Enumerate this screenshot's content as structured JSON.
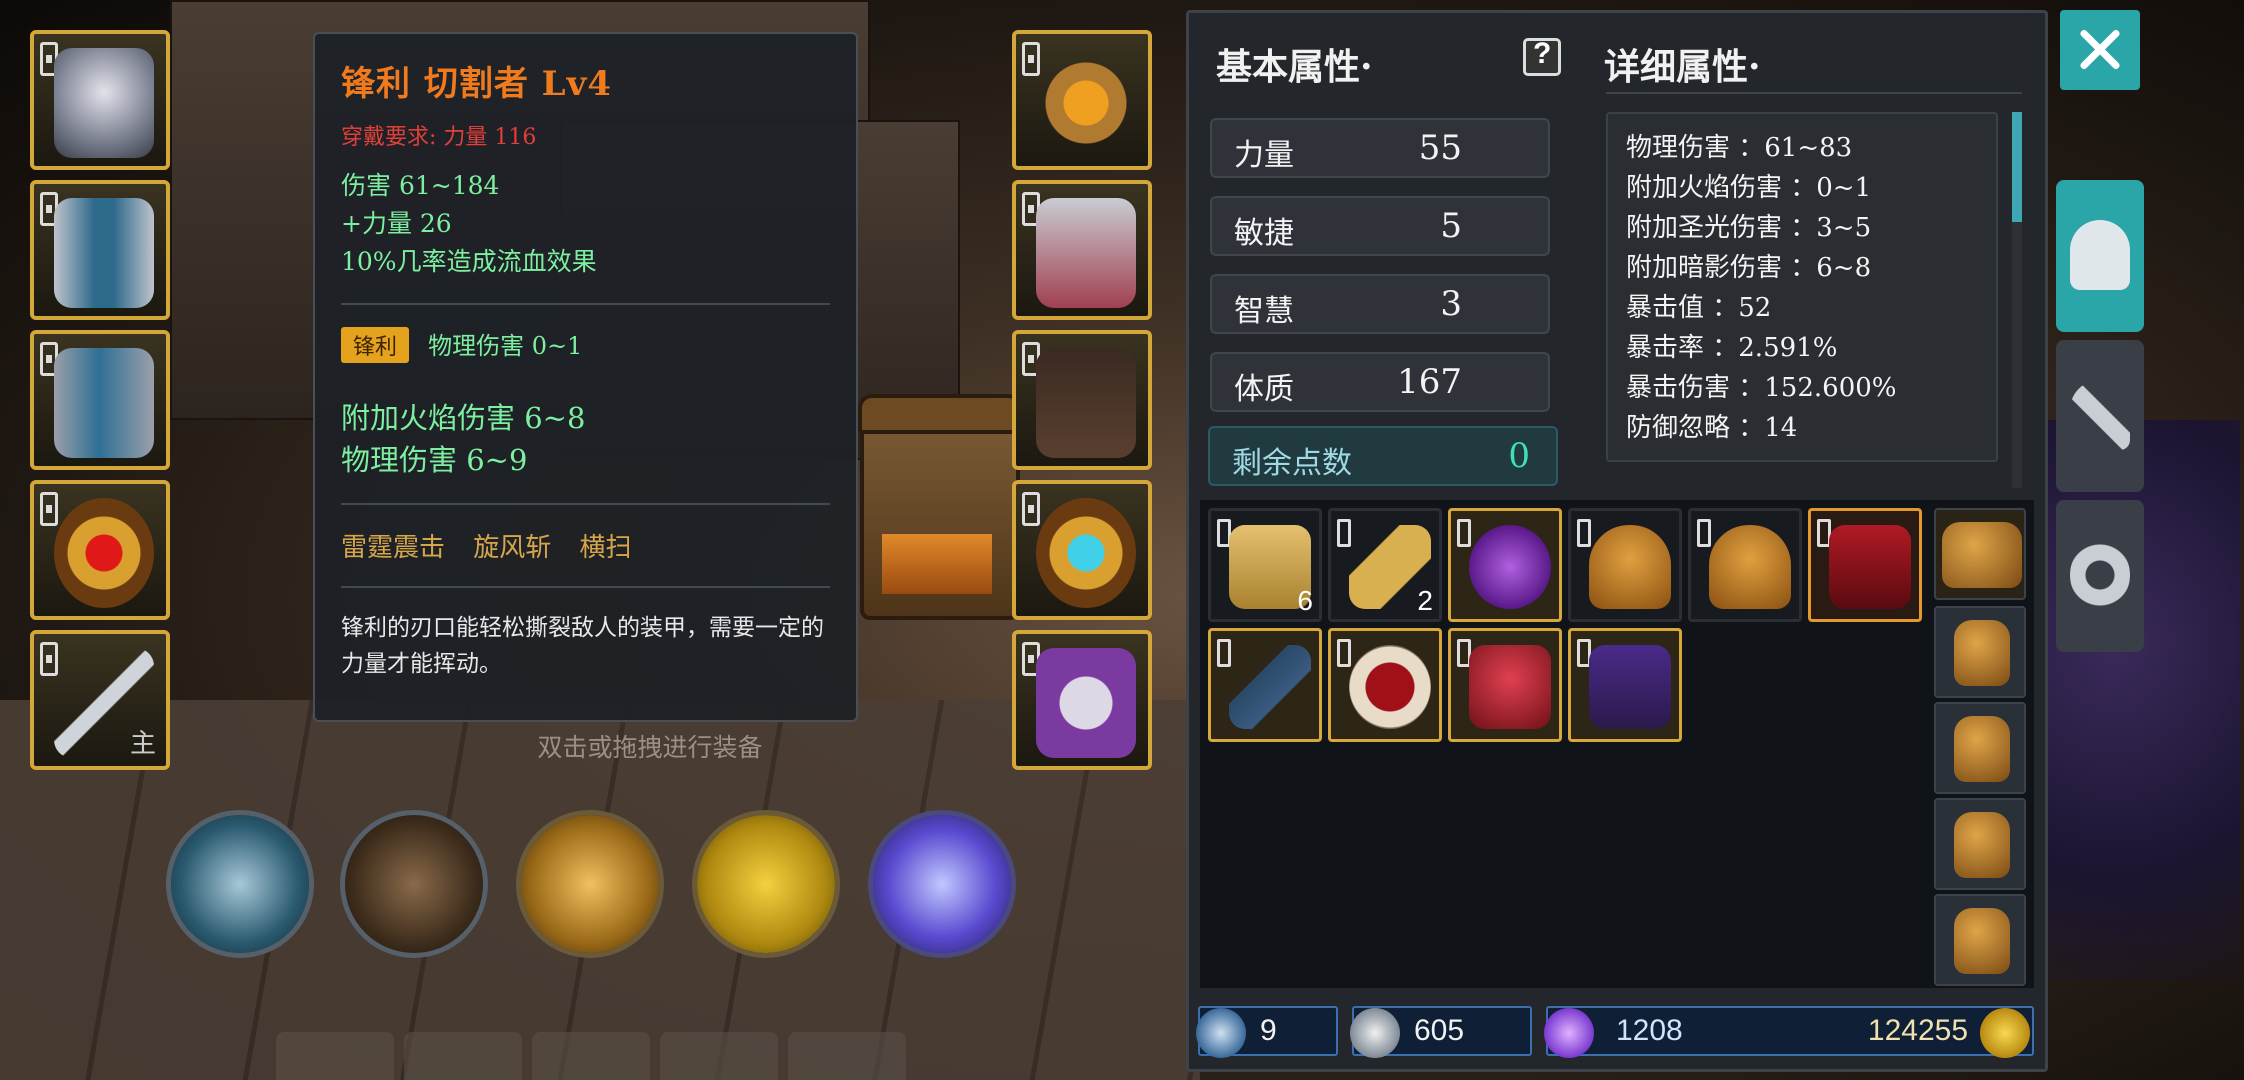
{
  "tooltip": {
    "title": "锋利 切割者 Lv4",
    "requirement": "穿戴要求:    力量 116",
    "lines": [
      "伤害   61~184",
      "+力量 26",
      "10%几率造成流血效果"
    ],
    "affix_badge": "锋利",
    "affix_text": "物理伤害 0~1",
    "bonus": [
      "附加火焰伤害  6~8",
      "物理伤害  6~9"
    ],
    "skills": "雷霆震击  旋风斩  横扫",
    "description": "锋利的刃口能轻松撕裂敌人的装甲，需要一定的力量才能挥动。"
  },
  "hint": "双击或拖拽进行装备",
  "left_slots": [
    {
      "icon": "helmet-icon"
    },
    {
      "icon": "armor-icon"
    },
    {
      "icon": "leg-armor-icon"
    },
    {
      "icon": "ring-icon"
    },
    {
      "icon": "sword-icon",
      "tag": "主"
    }
  ],
  "right_slots": [
    {
      "icon": "amulet-icon"
    },
    {
      "icon": "gloves-icon"
    },
    {
      "icon": "boots-icon"
    },
    {
      "icon": "ring-icon"
    },
    {
      "icon": "skull-offhand-icon"
    }
  ],
  "skills": [
    {
      "icon": "blade-skill-icon"
    },
    {
      "icon": "helmet-strike-skill-icon"
    },
    {
      "icon": "fist-burst-skill-icon"
    },
    {
      "icon": "dash-skill-icon"
    },
    {
      "icon": "boot-skill-icon"
    }
  ],
  "panel": {
    "basic_title": "基本属性·",
    "detail_title": "详细属性·",
    "stats": [
      {
        "label": "力量",
        "value": "55"
      },
      {
        "label": "敏捷",
        "value": "5"
      },
      {
        "label": "智慧",
        "value": "3"
      },
      {
        "label": "体质",
        "value": "167"
      }
    ],
    "remaining": {
      "label": "剩余点数",
      "value": "0"
    },
    "details": [
      "物理伤害 ：61~83",
      "附加火焰伤害 ：0~1",
      "附加圣光伤害 ：3~5",
      "附加暗影伤害 ：6~8",
      "暴击值 ：52",
      "暴击率 ：2.591%",
      "暴击伤害 ：152.600%",
      "防御忽略 ：14"
    ]
  },
  "inventory": {
    "row1": [
      {
        "icon": "scroll-map-icon",
        "count": "6"
      },
      {
        "icon": "scroll-tube-icon",
        "count": "2"
      },
      {
        "icon": "purple-potion-icon",
        "count": ""
      },
      {
        "icon": "leather-pouch-icon",
        "count": ""
      },
      {
        "icon": "leather-pouch-icon",
        "count": ""
      },
      {
        "icon": "red-cape-icon",
        "count": ""
      }
    ],
    "row2": [
      {
        "icon": "dark-staff-icon"
      },
      {
        "icon": "red-gem-ring-icon"
      },
      {
        "icon": "red-axe-icon"
      },
      {
        "icon": "purple-claw-icon"
      }
    ],
    "bags": [
      "bag-icon",
      "bag-icon",
      "bag-icon",
      "bag-icon",
      "bag-icon"
    ]
  },
  "currency": {
    "wand": "9",
    "shards": "605",
    "crystal": "1208",
    "gold": "124255"
  },
  "colors": {
    "accent": "#2aa6a8",
    "title_orange": "#f07a1e",
    "stat_green": "#7cf0a0",
    "requirement_red": "#e0403a"
  }
}
